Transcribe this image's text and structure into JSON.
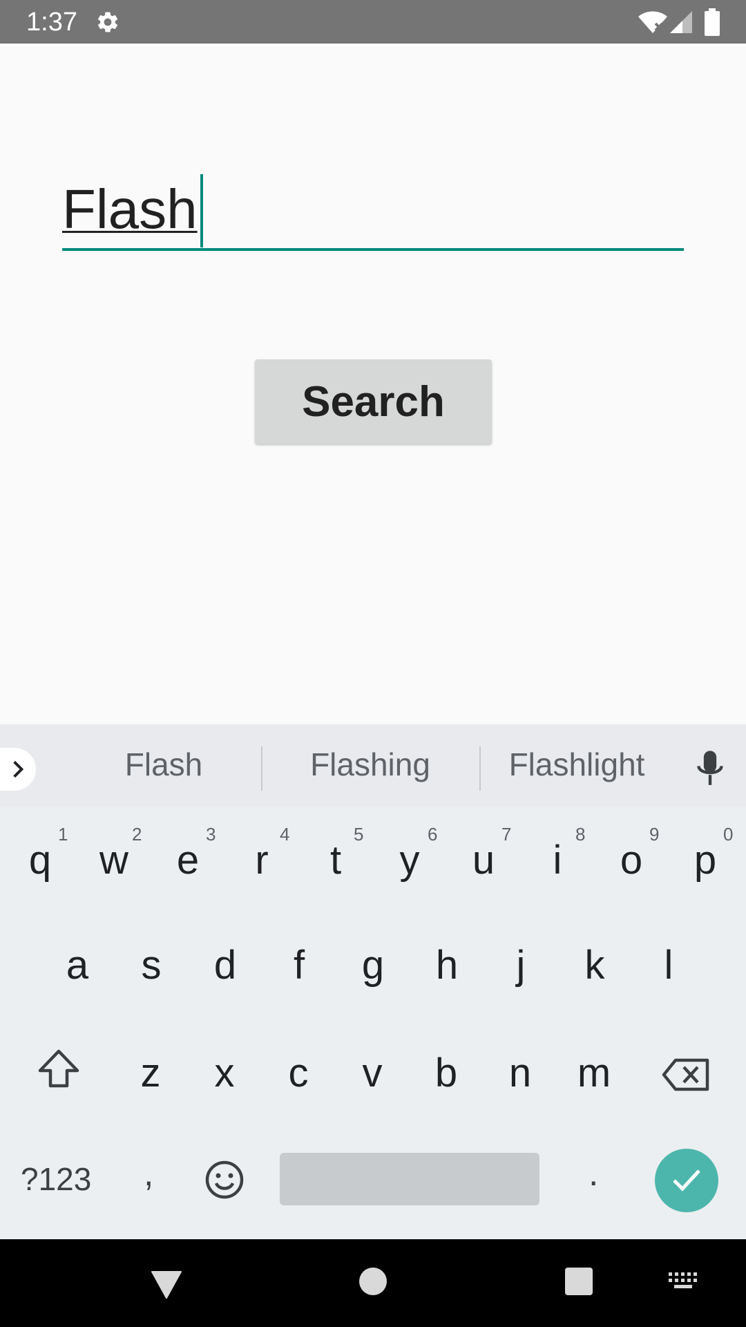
{
  "status_bar": {
    "time": "1:37",
    "icons": [
      "gear-icon",
      "wifi-icon",
      "signal-icon",
      "battery-icon"
    ]
  },
  "search_field": {
    "value": "Flash",
    "underline_color": "#00897b"
  },
  "search_button": {
    "label": "Search"
  },
  "keyboard": {
    "suggestions": [
      "Flash",
      "Flashing",
      "Flashlight"
    ],
    "row1": [
      {
        "key": "q",
        "hint": "1"
      },
      {
        "key": "w",
        "hint": "2"
      },
      {
        "key": "e",
        "hint": "3"
      },
      {
        "key": "r",
        "hint": "4"
      },
      {
        "key": "t",
        "hint": "5"
      },
      {
        "key": "y",
        "hint": "6"
      },
      {
        "key": "u",
        "hint": "7"
      },
      {
        "key": "i",
        "hint": "8"
      },
      {
        "key": "o",
        "hint": "9"
      },
      {
        "key": "p",
        "hint": "0"
      }
    ],
    "row2": [
      "a",
      "s",
      "d",
      "f",
      "g",
      "h",
      "j",
      "k",
      "l"
    ],
    "row3": [
      "z",
      "x",
      "c",
      "v",
      "b",
      "n",
      "m"
    ],
    "symbols_label": "?123",
    "comma_label": ",",
    "period_label": ".",
    "enter_color": "#4db6ac"
  },
  "nav_bar": {
    "icons": [
      "back-icon",
      "home-icon",
      "recents-icon",
      "keyboard-switch-icon"
    ]
  }
}
